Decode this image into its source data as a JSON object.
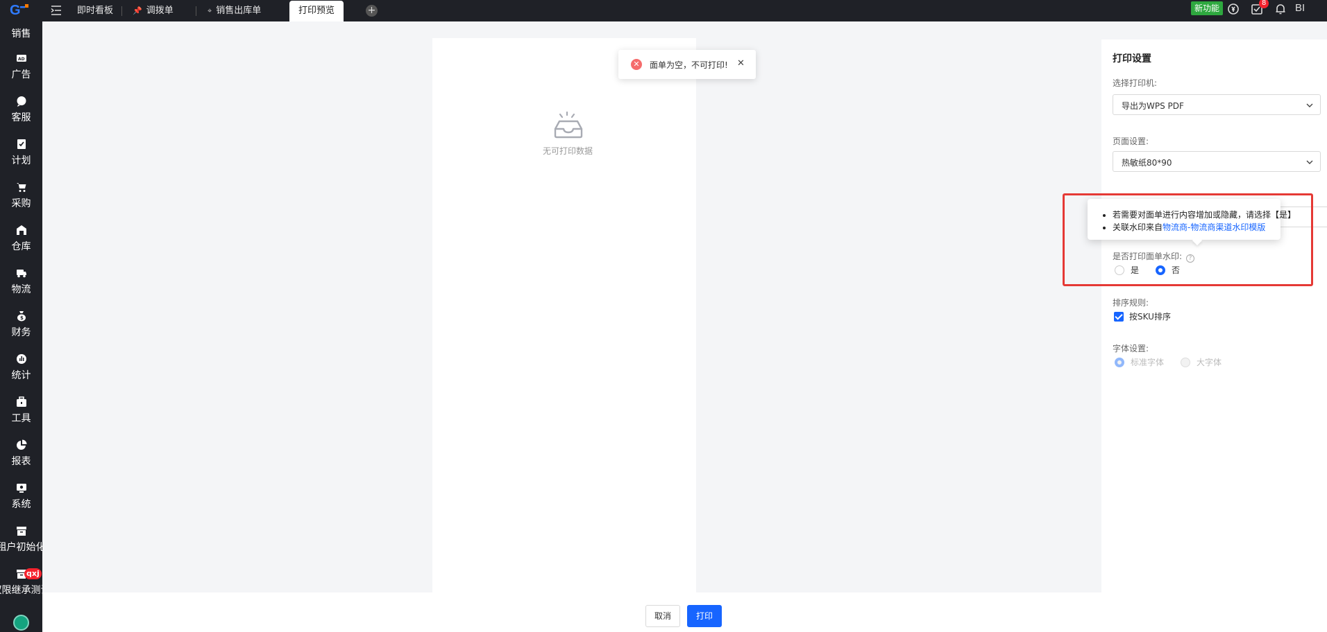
{
  "sidebar": {
    "items": [
      {
        "label": "销售",
        "icon": "sales-icon"
      },
      {
        "label": "广告",
        "icon": "ad-icon"
      },
      {
        "label": "客服",
        "icon": "chat-icon"
      },
      {
        "label": "计划",
        "icon": "plan-icon"
      },
      {
        "label": "采购",
        "icon": "cart-icon"
      },
      {
        "label": "仓库",
        "icon": "warehouse-icon"
      },
      {
        "label": "物流",
        "icon": "truck-icon"
      },
      {
        "label": "财务",
        "icon": "money-bag-icon"
      },
      {
        "label": "统计",
        "icon": "stats-icon"
      },
      {
        "label": "工具",
        "icon": "toolbox-icon"
      },
      {
        "label": "报表",
        "icon": "pie-chart-icon"
      },
      {
        "label": "系统",
        "icon": "system-icon"
      },
      {
        "label": "租户初始化",
        "icon": "archive-icon"
      },
      {
        "label": "权限继承测试",
        "icon": "archive-icon",
        "badge": "qxj"
      }
    ]
  },
  "topbar": {
    "tabs": [
      {
        "label": "即时看板"
      },
      {
        "label": "调拨单"
      },
      {
        "label": "销售出库单"
      },
      {
        "label": "打印预览"
      }
    ],
    "new_feature": "新功能",
    "notification_count": "8",
    "bi_label": "BI"
  },
  "preview": {
    "empty_text": "无可打印数据"
  },
  "toast": {
    "message": "面单为空，不可打印!"
  },
  "panel": {
    "title": "打印设置",
    "printer_label": "选择打印机:",
    "printer_value": "导出为WPS PDF",
    "page_label": "页面设置:",
    "page_value": "热敏纸80*90",
    "watermark_label": "是否打印面单水印:",
    "watermark_yes": "是",
    "watermark_no": "否",
    "sort_label": "排序规则:",
    "sort_option": "按SKU排序",
    "font_label": "字体设置:",
    "font_standard": "标准字体",
    "font_large": "大字体"
  },
  "tooltip": {
    "line1": "若需要对面单进行内容增加或隐藏，请选择【是】",
    "line2_prefix": "关联水印来自",
    "line2_link": "物流商-物流商渠道水印模版"
  },
  "footer": {
    "cancel": "取消",
    "print": "打印"
  },
  "colors": {
    "sidebar_bg": "#1f2127",
    "primary": "#1765ff",
    "highlight": "#e53935",
    "new_feature": "#2ea83f"
  }
}
